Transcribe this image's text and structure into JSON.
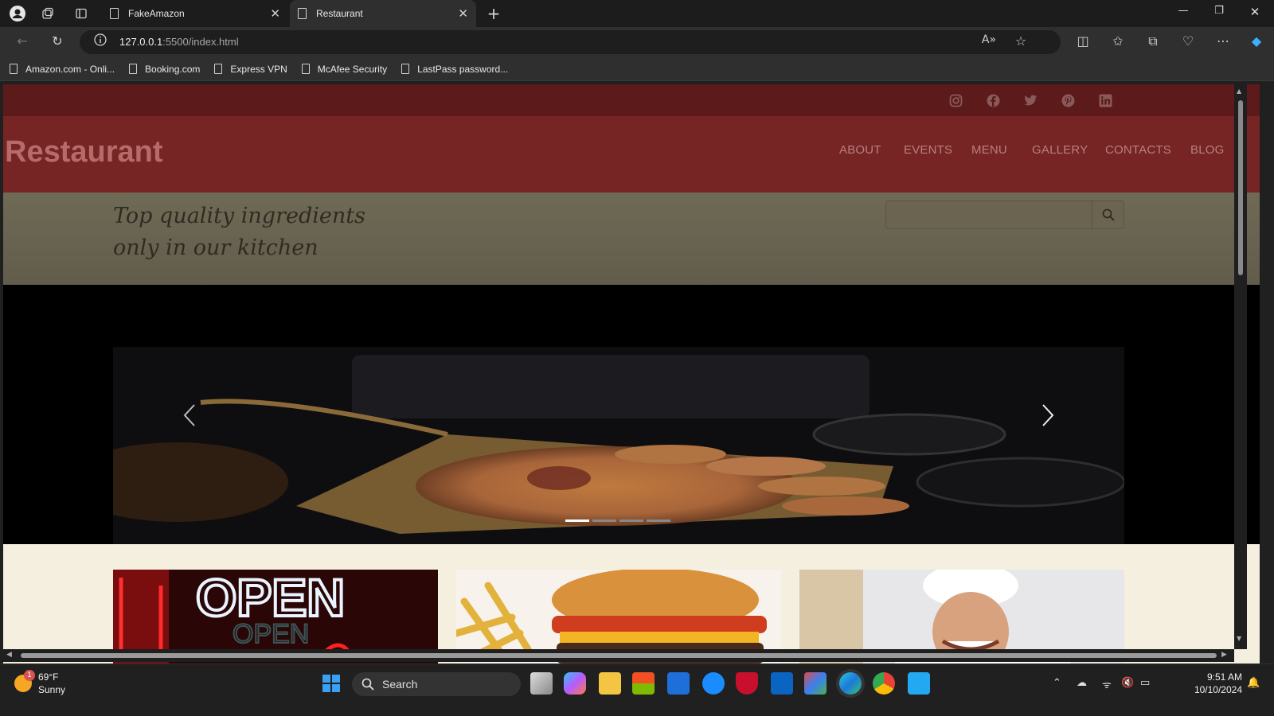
{
  "browser": {
    "tabs": [
      {
        "title": "FakeAmazon"
      },
      {
        "title": "Restaurant"
      }
    ],
    "url": {
      "host": "127.0.0.1",
      "path": ":5500/index.html"
    },
    "bookmarks": [
      "Amazon.com - Onli...",
      "Booking.com",
      "Express VPN",
      "McAfee Security",
      "LastPass password..."
    ]
  },
  "site": {
    "brand": "Restaurant",
    "social": [
      "instagram-icon",
      "facebook-icon",
      "twitter-icon",
      "pinterest-icon",
      "linkedin-icon"
    ],
    "nav": [
      "ABOUT",
      "EVENTS",
      "MENU",
      "GALLERY",
      "CONTACTS",
      "BLOG"
    ],
    "tagline": {
      "line1": "Top quality ingredients",
      "line2": "only in our kitchen"
    },
    "search": {
      "placeholder": ""
    },
    "carousel": {
      "indicators": 4,
      "active_index": 0
    },
    "cards": [
      "open-sign-image",
      "burger-image",
      "chef-image"
    ]
  },
  "taskbar": {
    "search_label": "Search",
    "weather": {
      "temp": "69°F",
      "condition": "Sunny",
      "badge": "1"
    },
    "clock": {
      "time": "9:51 AM",
      "date": "10/10/2024"
    }
  },
  "colors": {
    "header_red": "#762424",
    "strip_red": "#5c1a1a",
    "tag_band": "#6a6451",
    "cream": "#f5efe0"
  }
}
